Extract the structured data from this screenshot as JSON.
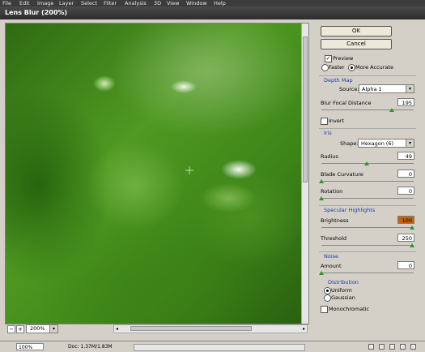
{
  "menubar": {
    "items": [
      "File",
      "Edit",
      "Image",
      "Layer",
      "Select",
      "Filter",
      "Analysis",
      "3D",
      "View",
      "Window",
      "Help"
    ]
  },
  "dialog": {
    "title": "Lens Blur (200%)"
  },
  "preview": {
    "zoom": "200%",
    "zoom_in_icon": "+",
    "zoom_out_icon": "−"
  },
  "buttons": {
    "ok": "OK",
    "cancel": "Cancel"
  },
  "options": {
    "preview_label": "Preview",
    "preview_checked": true,
    "faster_label": "Faster",
    "more_accurate_label": "More Accurate",
    "mode_selected": "More Accurate"
  },
  "depth_map": {
    "header": "Depth Map",
    "source_label": "Source:",
    "source_value": "Alpha 1",
    "focal_label": "Blur Focal Distance",
    "focal_value": "195",
    "focal_level": 0.76,
    "invert_label": "Invert",
    "invert_checked": false
  },
  "iris": {
    "header": "Iris",
    "shape_label": "Shape:",
    "shape_value": "Hexagon (6)",
    "radius_label": "Radius",
    "radius_value": "49",
    "radius_level": 0.49,
    "curvature_label": "Blade Curvature",
    "curvature_value": "0",
    "rotation_label": "Rotation",
    "rotation_value": "0"
  },
  "specular": {
    "header": "Specular Highlights",
    "brightness_label": "Brightness",
    "brightness_value": "100",
    "threshold_label": "Threshold",
    "threshold_value": "250"
  },
  "noise": {
    "header": "Noise",
    "amount_label": "Amount",
    "amount_value": "0",
    "distribution_header": "Distribution",
    "uniform_label": "Uniform",
    "gaussian_label": "Gaussian",
    "distribution_selected": "Uniform",
    "mono_label": "Monochromatic",
    "mono_checked": false
  },
  "status": {
    "zoom": "100%",
    "doc": "Doc: 1.37M/1.83M"
  },
  "colors": {
    "accent": "#1c3f9c",
    "slider_thumb": "#2a9a2a",
    "highlight_field": "#c8620a"
  }
}
